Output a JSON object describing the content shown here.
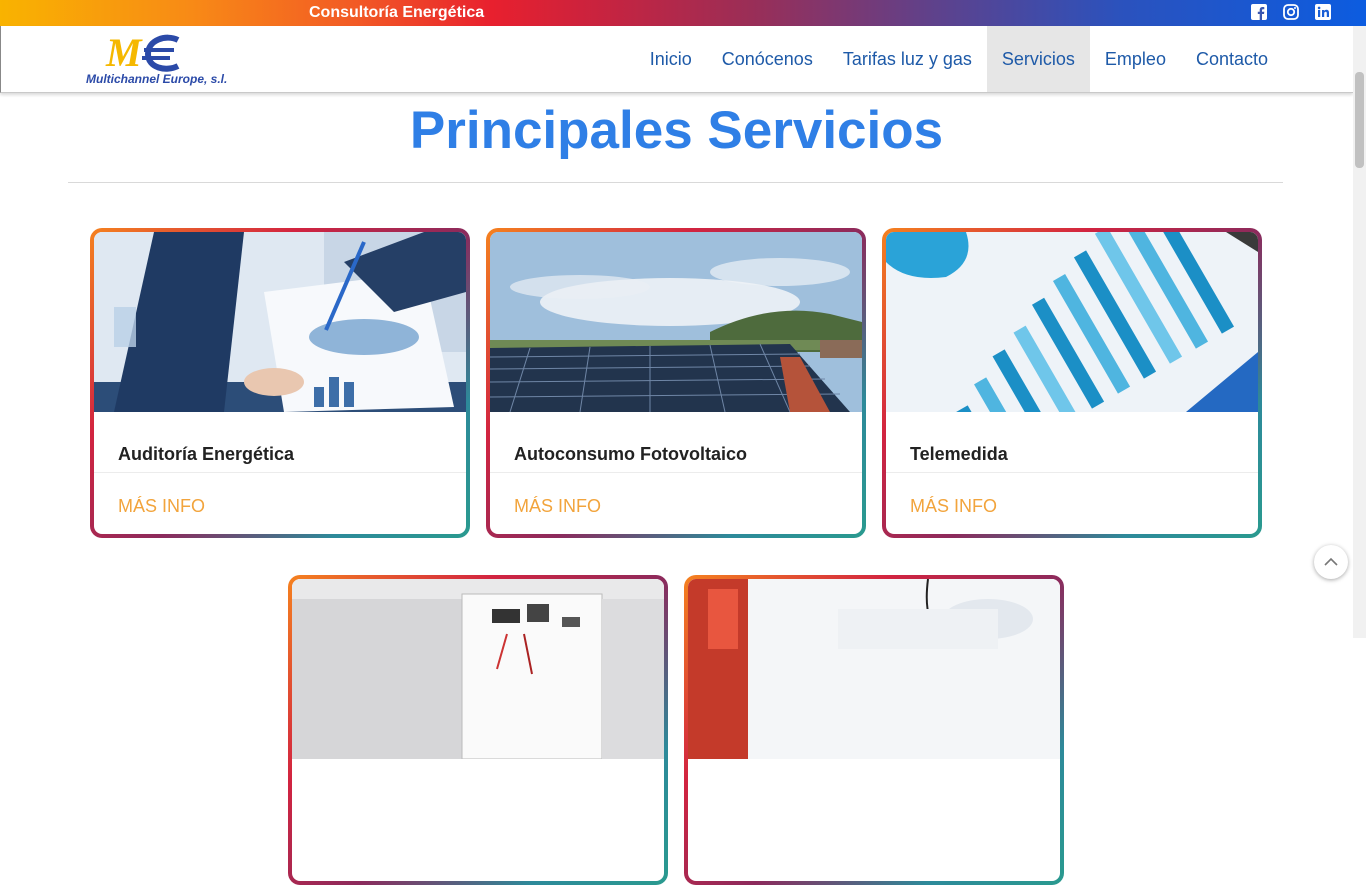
{
  "topbar": {
    "title": "Consultoría Energética"
  },
  "social": [
    "facebook-icon",
    "instagram-icon",
    "linkedin-icon"
  ],
  "logo": {
    "text": "Multichannel Europe, s.l."
  },
  "nav": {
    "items": [
      {
        "label": "Inicio"
      },
      {
        "label": "Conócenos"
      },
      {
        "label": "Tarifas luz y gas"
      },
      {
        "label": "Servicios",
        "active": true
      },
      {
        "label": "Empleo"
      },
      {
        "label": "Contacto"
      }
    ]
  },
  "main": {
    "heading": "Principales Servicios",
    "cards": [
      {
        "title": "Auditoría Energética",
        "link": "MÁS INFO"
      },
      {
        "title": "Autoconsumo Fotovoltaico",
        "link": "MÁS INFO"
      },
      {
        "title": "Telemedida",
        "link": "MÁS INFO"
      }
    ]
  },
  "colors": {
    "accent": "#2f7fe6",
    "nav": "#1e5aa8",
    "link": "#f2a43c"
  }
}
